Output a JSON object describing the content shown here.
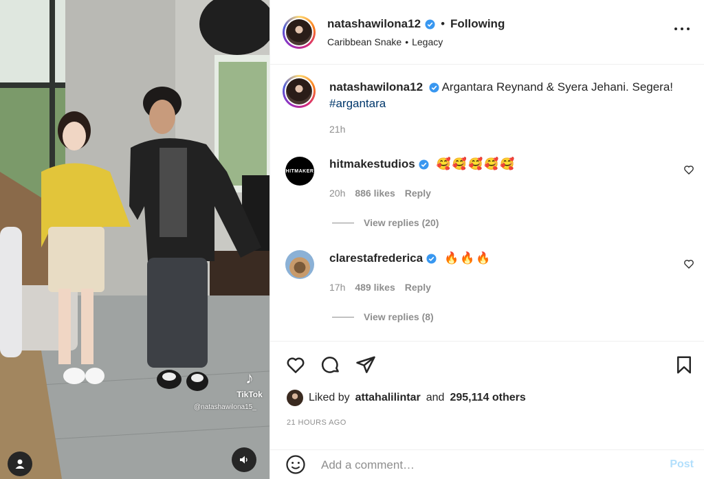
{
  "colors": {
    "link": "#00376b",
    "muted": "#8e8e8e",
    "verified": "#3897f0",
    "post_button": "#b2dffc",
    "text": "#262626"
  },
  "media": {
    "tiktok_logo": "♪",
    "tiktok_label": "TikTok",
    "tiktok_handle": "@natashawilona15_",
    "user_tag_icon": "user-icon",
    "mute_icon": "speaker-icon"
  },
  "header": {
    "username": "natashawilona12",
    "separator": "•",
    "follow_state": "Following",
    "audio_track": "Caribbean Snake",
    "audio_separator": "•",
    "audio_artist": "Legacy",
    "more_icon": "more-horizontal-icon"
  },
  "caption": {
    "username": "natashawilona12",
    "text": "Argantara Reynand & Syera Jehani. Segera!",
    "hashtag": "#argantara",
    "time": "21h"
  },
  "comments": [
    {
      "username": "hitmakestudios",
      "avatar_text": "HITMAKER",
      "text": "🥰🥰🥰🥰🥰",
      "time": "20h",
      "likes": "886 likes",
      "reply": "Reply",
      "view_replies": "View replies (20)"
    },
    {
      "username": "clarestafrederica",
      "text": "🔥🔥🔥",
      "time": "17h",
      "likes": "489 likes",
      "reply": "Reply",
      "view_replies": "View replies (8)"
    }
  ],
  "actions": {
    "icons": [
      "heart-icon",
      "comment-icon",
      "share-icon",
      "bookmark-icon"
    ],
    "liked_by_prefix": "Liked by",
    "liked_by_user": "attahalilintar",
    "liked_by_and": "and",
    "liked_by_others": "295,114 others",
    "post_age": "21 HOURS AGO"
  },
  "comment_box": {
    "emoji_icon": "emoji-icon",
    "placeholder": "Add a comment…",
    "post_label": "Post"
  }
}
